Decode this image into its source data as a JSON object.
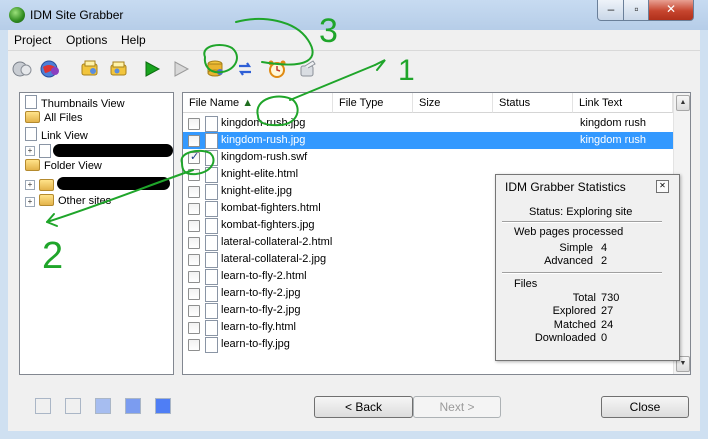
{
  "window": {
    "title": "IDM Site Grabber"
  },
  "menu": [
    "Project",
    "Options",
    "Help"
  ],
  "toolbar_icons": [
    "globe-icon",
    "site-globe-icon",
    "grab-files-icon",
    "grab-folder-icon",
    "start-icon",
    "stop-icon",
    "database-icon",
    "refresh-icon",
    "alarm-clock-icon",
    "settings-icon"
  ],
  "tree": {
    "thumbnails_view": "Thumbnails View",
    "all_files": "All Files",
    "link_view": "Link View",
    "folder_view": "Folder View",
    "other_sites": "Other sites"
  },
  "file_list": {
    "columns": [
      "File Name",
      "File Type",
      "Size",
      "Status",
      "Link Text"
    ],
    "rows": [
      {
        "name": "kingdom-rush.jpg",
        "link": "kingdom rush",
        "checked": false,
        "selected": false
      },
      {
        "name": "kingdom-rush.jpg",
        "link": "kingdom rush",
        "checked": false,
        "selected": true
      },
      {
        "name": "kingdom-rush.swf",
        "link": "",
        "checked": true,
        "selected": false
      },
      {
        "name": "knight-elite.html",
        "link": "",
        "checked": false,
        "selected": false
      },
      {
        "name": "knight-elite.jpg",
        "link": "",
        "checked": false,
        "selected": false
      },
      {
        "name": "kombat-fighters.html",
        "link": "",
        "checked": false,
        "selected": false
      },
      {
        "name": "kombat-fighters.jpg",
        "link": "",
        "checked": false,
        "selected": false
      },
      {
        "name": "lateral-collateral-2.html",
        "link": "",
        "checked": false,
        "selected": false
      },
      {
        "name": "lateral-collateral-2.jpg",
        "link": "",
        "checked": false,
        "selected": false
      },
      {
        "name": "learn-to-fly-2.html",
        "link": "",
        "checked": false,
        "selected": false
      },
      {
        "name": "learn-to-fly-2.jpg",
        "link": "",
        "checked": false,
        "selected": false
      },
      {
        "name": "learn-to-fly-2.jpg",
        "link": "",
        "checked": false,
        "selected": false
      },
      {
        "name": "learn-to-fly.html",
        "link": "",
        "checked": false,
        "selected": false
      },
      {
        "name": "learn-to-fly.jpg",
        "link": "",
        "checked": false,
        "selected": false
      }
    ]
  },
  "stats": {
    "title": "IDM Grabber Statistics",
    "status": "Status: Exploring site",
    "web_pages_heading": "Web pages processed",
    "simple_label": "Simple",
    "simple_value": "4",
    "advanced_label": "Advanced",
    "advanced_value": "2",
    "files_heading": "Files",
    "total_label": "Total",
    "total_value": "730",
    "explored_label": "Explored",
    "explored_value": "27",
    "matched_label": "Matched",
    "matched_value": "24",
    "downloaded_label": "Downloaded",
    "downloaded_value": "0"
  },
  "buttons": {
    "back": "< Back",
    "next": "Next >",
    "close": "Close"
  },
  "annotations": {
    "n1": "1",
    "n2": "2",
    "n3": "3",
    "color": "#1fa52a"
  },
  "colors": {
    "selection": "#3399ff",
    "swatches": [
      "#f0f0f0",
      "#f0f0f0",
      "#a6bdf0",
      "#7b9cf0",
      "#4f7ef5"
    ]
  }
}
